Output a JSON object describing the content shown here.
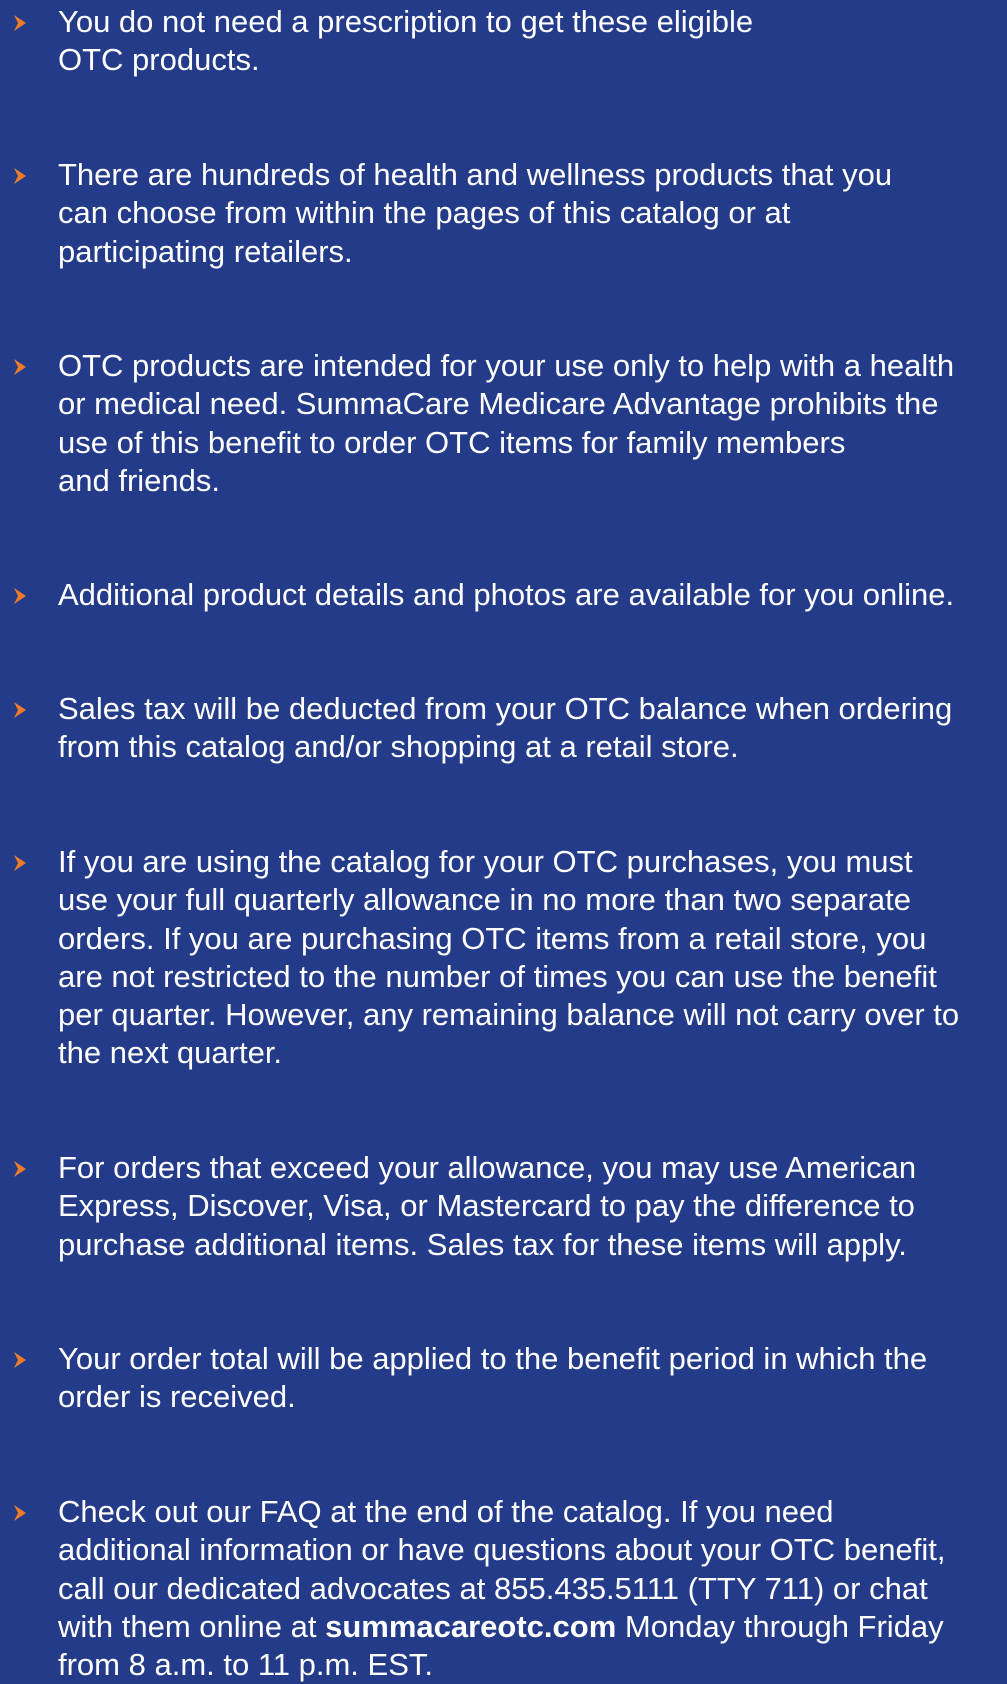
{
  "accent_color": "#f07c2a",
  "background_color": "#243b8a",
  "items": [
    {
      "icon": "chevron-right-icon",
      "lines": [
        "You do not need a prescription to get these eligible",
        "OTC products."
      ]
    },
    {
      "icon": "chevron-right-icon",
      "lines": [
        "There are hundreds of health and wellness products that you",
        "can choose from within the pages of this catalog or at",
        "participating retailers."
      ]
    },
    {
      "icon": "chevron-right-icon",
      "lines": [
        "OTC products are intended for your use only to help with a health",
        "or medical need. SummaCare Medicare Advantage prohibits the",
        "use of this benefit to order OTC items for family members",
        "and friends."
      ]
    },
    {
      "icon": "chevron-right-icon",
      "lines": [
        "Additional product details and photos are available for you online."
      ]
    },
    {
      "icon": "chevron-right-icon",
      "lines": [
        "Sales tax will be deducted from your OTC balance when ordering",
        "from this catalog and/or shopping at a retail store."
      ]
    },
    {
      "icon": "chevron-right-icon",
      "lines": [
        "If you are using the catalog for your OTC purchases, you must",
        "use your full quarterly allowance in no more than two separate",
        "orders. If you are purchasing OTC items from a retail store, you",
        "are not restricted to the number of times you can use the benefit",
        "per quarter. However, any remaining balance will not carry over to",
        "the next quarter."
      ]
    },
    {
      "icon": "chevron-right-icon",
      "lines": [
        "For orders that exceed your allowance, you may use American",
        "Express, Discover, Visa, or Mastercard to pay the difference to",
        "purchase additional items. Sales tax for these items will apply."
      ]
    },
    {
      "icon": "chevron-right-icon",
      "lines": [
        "Your order total will be applied to the benefit period in which the",
        "order is received."
      ]
    },
    {
      "icon": "chevron-right-icon",
      "lines": [
        "Check out our FAQ at the end of the catalog. If you need",
        "additional information or have questions about your OTC benefit,",
        "call our dedicated advocates at 855.435.5111 (TTY 711) or chat"
      ],
      "mixed_line": {
        "before": "with them online at ",
        "link": "summacareotc.com",
        "after": " Monday through Friday"
      },
      "last_line": "from 8 a.m. to 11 p.m. EST."
    }
  ]
}
